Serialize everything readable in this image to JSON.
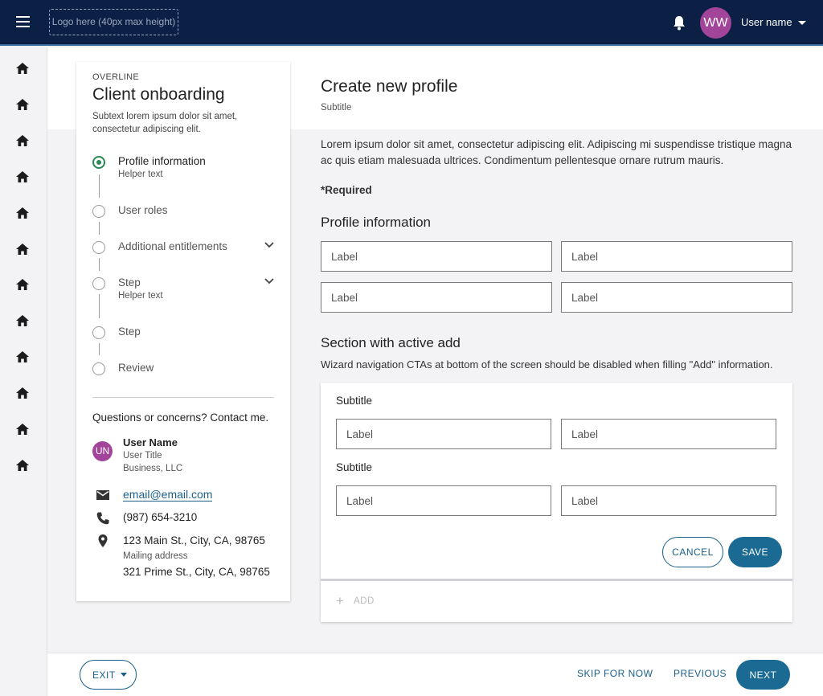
{
  "topbar": {
    "logo_placeholder": "Logo here (40px max height)",
    "avatar_initials": "WW",
    "user_name": "User name",
    "icons": [
      "menu-icon",
      "bell-icon",
      "caret-down-icon"
    ]
  },
  "rail": {
    "item_count": 12,
    "icon": "home-icon"
  },
  "wizard": {
    "overline": "OVERLINE",
    "title": "Client onboarding",
    "subtext": "Subtext lorem ipsum dolor sit amet, consectetur adipiscing elit.",
    "steps": [
      {
        "label": "Profile information",
        "helper": "Helper text",
        "active": true,
        "expandable": false
      },
      {
        "label": "User roles",
        "helper": "",
        "active": false,
        "expandable": false
      },
      {
        "label": "Additional entitlements",
        "helper": "",
        "active": false,
        "expandable": true
      },
      {
        "label": "Step",
        "helper": "Helper text",
        "active": false,
        "expandable": true
      },
      {
        "label": "Step",
        "helper": "",
        "active": false,
        "expandable": false
      },
      {
        "label": "Review",
        "helper": "",
        "active": false,
        "expandable": false
      }
    ],
    "contact": {
      "title": "Questions or concerns? Contact me.",
      "initials": "UN",
      "name": "User Name",
      "job_title": "User Title",
      "business": "Business, LLC",
      "email": "email@email.com",
      "phone": "(987) 654-3210",
      "address": "123 Main St., City, CA, 98765",
      "mailing_label": "Mailing address",
      "mailing_address": "321 Prime St., City, CA, 98765"
    }
  },
  "main": {
    "title": "Create new profile",
    "subtitle": "Subtitle",
    "intro": "Lorem ipsum dolor sit amet, consectetur adipiscing elit. Adipiscing mi suspendisse tristique magna ac quis etiam malesuada ultrices. Condimentum pellentesque ornare rutrum mauris.",
    "required": "*Required",
    "profile_section": {
      "heading": "Profile information",
      "fields": [
        "Label",
        "Label",
        "Label",
        "Label"
      ]
    },
    "add_section": {
      "heading": "Section with active add",
      "description": "Wizard navigation CTAs at bottom of the screen should be disabled when filling \"Add\" information.",
      "groups": [
        {
          "subtitle": "Subtitle",
          "fields": [
            "Label",
            "Label"
          ]
        },
        {
          "subtitle": "Subtitle",
          "fields": [
            "Label",
            "Label"
          ]
        }
      ],
      "cancel_label": "CANCEL",
      "save_label": "SAVE",
      "add_label": "ADD"
    }
  },
  "bottombar": {
    "exit_label": "EXIT",
    "skip_label": "SKIP FOR NOW",
    "previous_label": "PREVIOUS",
    "next_label": "NEXT"
  },
  "colors": {
    "topbar": "#0c1f45",
    "primary": "#1a6a94",
    "link": "#1a5f8a",
    "avatar": "#a2449a",
    "step_active": "#2a8a55"
  }
}
